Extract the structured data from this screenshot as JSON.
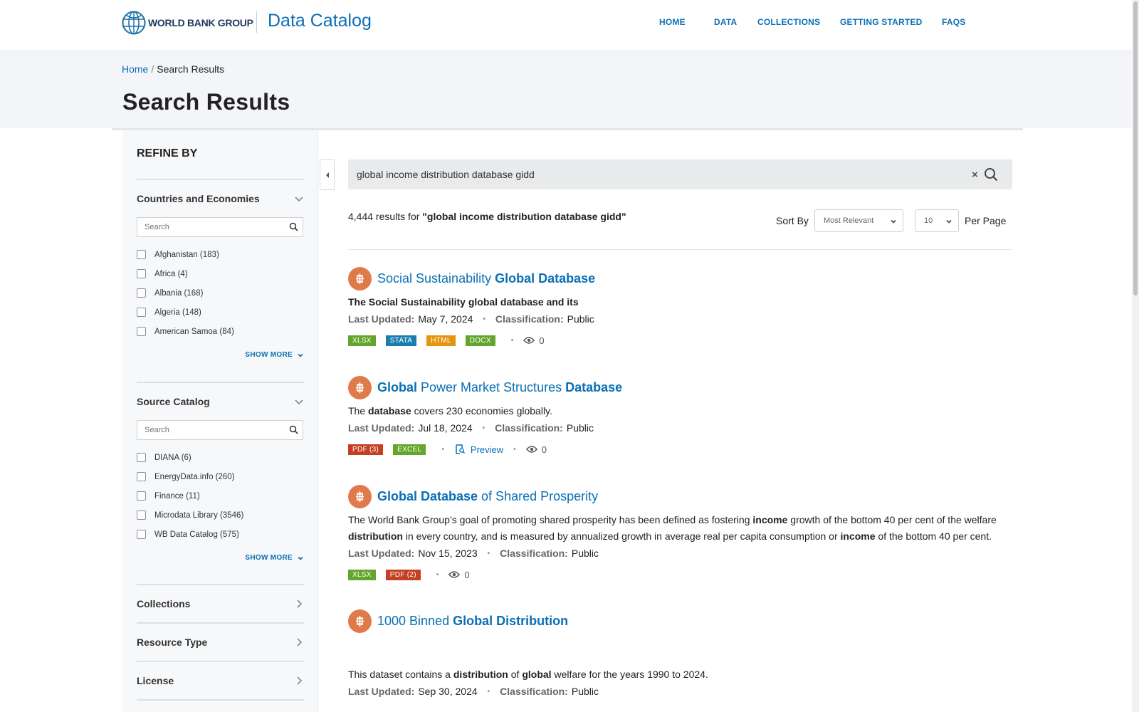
{
  "header": {
    "logo_text": "WORLD BANK GROUP",
    "catalog_title": "Data Catalog",
    "nav": [
      "HOME",
      "DATA",
      "COLLECTIONS",
      "GETTING STARTED",
      "FAQS"
    ]
  },
  "breadcrumb": {
    "home": "Home",
    "separator": "/",
    "current": "Search Results"
  },
  "page_title": "Search Results",
  "sidebar": {
    "title": "REFINE BY",
    "search_placeholder": "Search",
    "show_more": "SHOW MORE",
    "countries": {
      "title": "Countries and Economies",
      "items": [
        "Afghanistan (183)",
        "Africa (4)",
        "Albania (168)",
        "Algeria (148)",
        "American Samoa (84)"
      ]
    },
    "source": {
      "title": "Source Catalog",
      "items": [
        "DIANA (6)",
        "EnergyData.info (260)",
        "Finance (11)",
        "Microdata Library (3546)",
        "WB Data Catalog (575)"
      ]
    },
    "collapsed": [
      "Collections",
      "Resource Type",
      "License"
    ]
  },
  "search": {
    "query": "global income distribution database gidd"
  },
  "results_summary": {
    "count": "4,444",
    "mid": " results for ",
    "query": "\"global income distribution database gidd\""
  },
  "sort": {
    "label": "Sort By",
    "value": "Most Relevant",
    "per_page_value": "10",
    "per_page_label": "Per Page"
  },
  "labels": {
    "last_updated": "Last Updated:",
    "classification": "Classification:",
    "preview": "Preview",
    "bullet": "•"
  },
  "results": [
    {
      "title_a": "Social Sustainability ",
      "title_b": "Global Database",
      "desc_b": "The Social Sustainability global database and its",
      "date": "May 7, 2024",
      "class": "Public",
      "tags": [
        "XLSX",
        "STATA",
        "HTML",
        "DOCX"
      ],
      "views": "0"
    },
    {
      "title_a": "Global",
      "title_b": " Power Market Structures ",
      "title_c": "Database",
      "desc_1": "The ",
      "desc_2": "database",
      "desc_3": " covers 230 economies globally.",
      "date": "Jul 18, 2024",
      "class": "Public",
      "tags": [
        "PDF (3)",
        "EXCEL"
      ],
      "views": "0"
    },
    {
      "title_a": "Global Database",
      "title_b": " of Shared Prosperity",
      "desc_1": "The World Bank Group’s goal of promoting shared prosperity has been defined as fostering ",
      "desc_2": "income",
      "desc_3": " growth of the bottom 40 per cent of the welfare",
      "desc_4": "distribution",
      "desc_5": " in every country, and is measured by annualized growth in average real per capita consumption or ",
      "desc_6": "income",
      "desc_7": " of the bottom 40 per cent.",
      "date": "Nov 15, 2023",
      "class": "Public",
      "tags": [
        "XLSX",
        "PDF (2)"
      ],
      "views": "0"
    },
    {
      "title_a": "1000 Binned ",
      "title_b": "Global Distribution",
      "desc_1": "This dataset contains a ",
      "desc_2": "distribution",
      "desc_3": " of ",
      "desc_4": "global",
      "desc_5": " welfare for the years 1990 to 2024.",
      "date": "Sep 30, 2024",
      "class": "Public"
    }
  ],
  "colors": {
    "accent": "#0a6fb4",
    "icon_orange": "#e07a4a",
    "tag_green": "#63a62c",
    "tag_blue": "#1b7dad",
    "tag_orange": "#e5940e",
    "tag_red": "#c53f24"
  }
}
